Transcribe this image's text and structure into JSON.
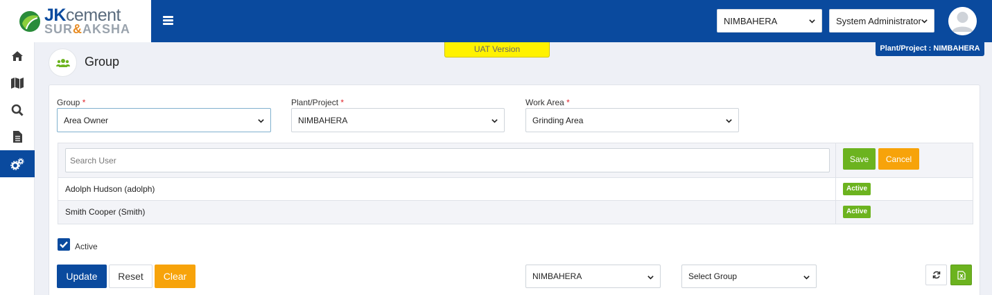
{
  "logo": {
    "brand_prefix": "JK",
    "brand_suffix": "cement",
    "sub_left": "SUR",
    "sub_amp": "&",
    "sub_right": "AKSHA"
  },
  "header": {
    "plant_select": "NIMBAHERA",
    "role_select": "System Administrator"
  },
  "sidebar": {
    "items": [
      {
        "icon": "home-icon"
      },
      {
        "icon": "map-icon"
      },
      {
        "icon": "search-icon"
      },
      {
        "icon": "document-icon"
      },
      {
        "icon": "settings-icon",
        "active": true
      }
    ]
  },
  "banner": {
    "uat": "UAT Version",
    "plant_badge": "Plant/Project : NIMBAHERA"
  },
  "page": {
    "title": "Group"
  },
  "form": {
    "group_label": "Group",
    "group_value": "Area Owner",
    "plant_label": "Plant/Project",
    "plant_value": "NIMBAHERA",
    "workarea_label": "Work Area",
    "workarea_value": "Grinding Area",
    "required_mark": "*"
  },
  "users": {
    "search_placeholder": "Search User",
    "save_label": "Save",
    "cancel_label": "Cancel",
    "rows": [
      {
        "name": "Adolph Hudson (adolph)",
        "status": "Active"
      },
      {
        "name": "Smith Cooper (Smith)",
        "status": "Active"
      }
    ]
  },
  "active_checkbox": {
    "label": "Active",
    "checked": true
  },
  "actions": {
    "update_label": "Update",
    "reset_label": "Reset",
    "clear_label": "Clear",
    "filter_plant": "NIMBAHERA",
    "filter_group": "Select Group"
  },
  "colors": {
    "primary": "#0a4a9e",
    "success": "#6cb31f",
    "warning": "#f7a30a",
    "uat": "#fff200"
  }
}
